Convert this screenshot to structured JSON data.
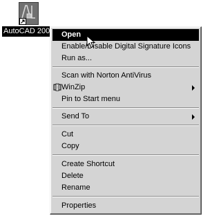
{
  "desktop": {
    "shortcut_label": "AutoCAD 200",
    "icon": "autocad-app-icon"
  },
  "menu": {
    "items": [
      {
        "label": "Open",
        "highlighted": true
      },
      {
        "label": "Enable/Disable Digital Signature Icons"
      },
      {
        "label": "Run as..."
      },
      {
        "label": "Scan with Norton AntiVirus"
      },
      {
        "label": "WinZip",
        "icon": "winzip-icon",
        "submenu": true
      },
      {
        "label": "Pin to Start menu"
      },
      {
        "label": "Send To",
        "submenu": true
      },
      {
        "label": "Cut"
      },
      {
        "label": "Copy"
      },
      {
        "label": "Create Shortcut"
      },
      {
        "label": "Delete"
      },
      {
        "label": "Rename"
      },
      {
        "label": "Properties"
      }
    ]
  },
  "colors": {
    "menu_background": "#d4d4d4",
    "highlight_background": "#000000",
    "highlight_text": "#ffffff"
  }
}
